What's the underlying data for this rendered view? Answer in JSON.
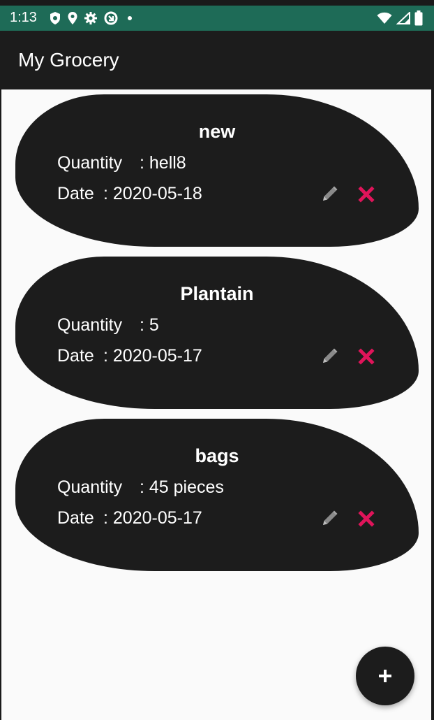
{
  "status_bar": {
    "time": "1:13"
  },
  "app_bar": {
    "title": "My Grocery"
  },
  "items": [
    {
      "name": "new",
      "quantity_label": "Quantity",
      "quantity_value": ": hell8",
      "date_label": "Date",
      "date_value": ": 2020-05-18"
    },
    {
      "name": "Plantain",
      "quantity_label": "Quantity",
      "quantity_value": ": 5",
      "date_label": "Date",
      "date_value": ": 2020-05-17"
    },
    {
      "name": "bags",
      "quantity_label": "Quantity",
      "quantity_value": ": 45 pieces",
      "date_label": "Date",
      "date_value": ": 2020-05-17"
    }
  ],
  "colors": {
    "status_bar": "#1e6b57",
    "app_bar": "#1c1c1c",
    "card": "#1c1c1c",
    "delete_icon": "#e0145a",
    "edit_icon": "#8a8a8a"
  },
  "icons": [
    "shield-icon",
    "location-icon",
    "settings-icon",
    "data-saver-icon",
    "dot-icon",
    "wifi-icon",
    "signal-icon",
    "battery-icon",
    "pencil-icon",
    "close-icon",
    "plus-icon"
  ]
}
